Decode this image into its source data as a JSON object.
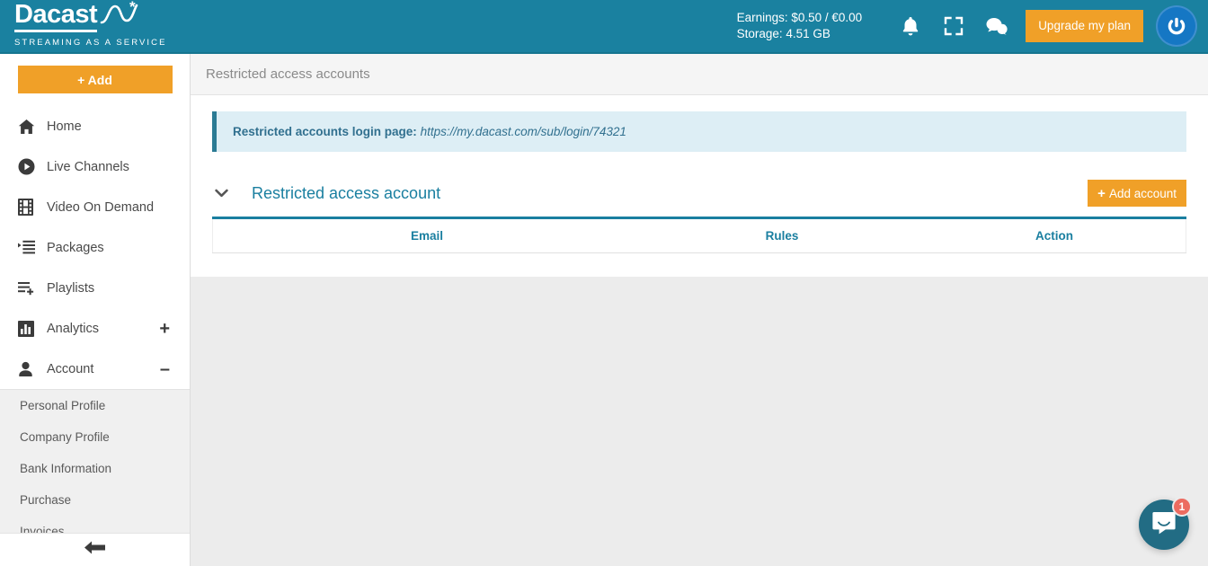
{
  "header": {
    "brand": {
      "name": "Dacast",
      "tagline": "STREAMING AS A SERVICE"
    },
    "earnings": "Earnings: $0.50 / €0.00",
    "storage": "Storage: 4.51 GB",
    "upgrade_label": "Upgrade my plan",
    "icons": {
      "notifications": "bell-icon",
      "fullscreen": "expand-icon",
      "chat": "chat-bubble-icon",
      "power": "power-icon"
    }
  },
  "sidebar": {
    "add_label": "+ Add",
    "items": [
      {
        "label": "Home",
        "icon": "home-icon",
        "toggle": ""
      },
      {
        "label": "Live Channels",
        "icon": "play-circle-icon",
        "toggle": ""
      },
      {
        "label": "Video On Demand",
        "icon": "film-icon",
        "toggle": ""
      },
      {
        "label": "Packages",
        "icon": "packages-icon",
        "toggle": ""
      },
      {
        "label": "Playlists",
        "icon": "playlist-add-icon",
        "toggle": ""
      },
      {
        "label": "Analytics",
        "icon": "bar-chart-icon",
        "toggle": "+"
      },
      {
        "label": "Account",
        "icon": "user-icon",
        "toggle": "–"
      }
    ],
    "sub_items": [
      {
        "label": "Personal Profile"
      },
      {
        "label": "Company Profile"
      },
      {
        "label": "Bank Information"
      },
      {
        "label": "Purchase"
      },
      {
        "label": "Invoices"
      }
    ],
    "collapse_icon": "arrow-left-icon"
  },
  "main": {
    "page_title": "Restricted access accounts",
    "banner": {
      "label": "Restricted accounts login page:",
      "url": "https://my.dacast.com/sub/login/74321"
    },
    "panel": {
      "title": "Restricted access account",
      "add_account_label": "Add account",
      "add_account_plus": "+",
      "columns": [
        "Email",
        "Rules",
        "Action"
      ],
      "rows": []
    }
  },
  "chat": {
    "badge": "1",
    "icon": "intercom-chat-icon"
  },
  "colors": {
    "header_teal": "#1a81a0",
    "accent_orange": "#f0a028",
    "link_teal": "#1a7fa0",
    "banner_bg": "#ddeef5",
    "page_bg": "#ececec"
  }
}
